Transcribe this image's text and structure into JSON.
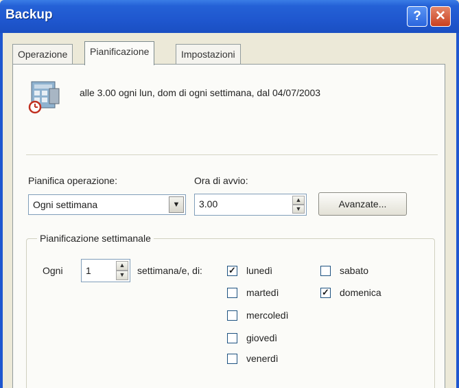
{
  "window": {
    "title": "Backup",
    "help_glyph": "?",
    "close_glyph": "✕"
  },
  "tabs": [
    {
      "label": "Operazione"
    },
    {
      "label": "Pianificazione"
    },
    {
      "label": "Impostazioni"
    }
  ],
  "summary": {
    "icon": "scheduled-task-icon",
    "text": "alle 3.00 ogni lun, dom di ogni settimana, dal 04/07/2003"
  },
  "schedule": {
    "schedule_label": "Pianifica operazione:",
    "schedule_value": "Ogni settimana",
    "start_label": "Ora di avvio:",
    "start_value": "3.00",
    "advanced_label": "Avanzate..."
  },
  "weekly": {
    "group_title": "Pianificazione settimanale",
    "every_label": "Ogni",
    "every_value": "1",
    "weeks_label": "settimana/e, di:",
    "days": [
      {
        "label": "lunedì",
        "checked": true
      },
      {
        "label": "martedì",
        "checked": false
      },
      {
        "label": "mercoledì",
        "checked": false
      },
      {
        "label": "giovedì",
        "checked": false
      },
      {
        "label": "venerdì",
        "checked": false
      },
      {
        "label": "sabato",
        "checked": false
      },
      {
        "label": "domenica",
        "checked": true
      }
    ]
  },
  "check_glyph": "✓"
}
